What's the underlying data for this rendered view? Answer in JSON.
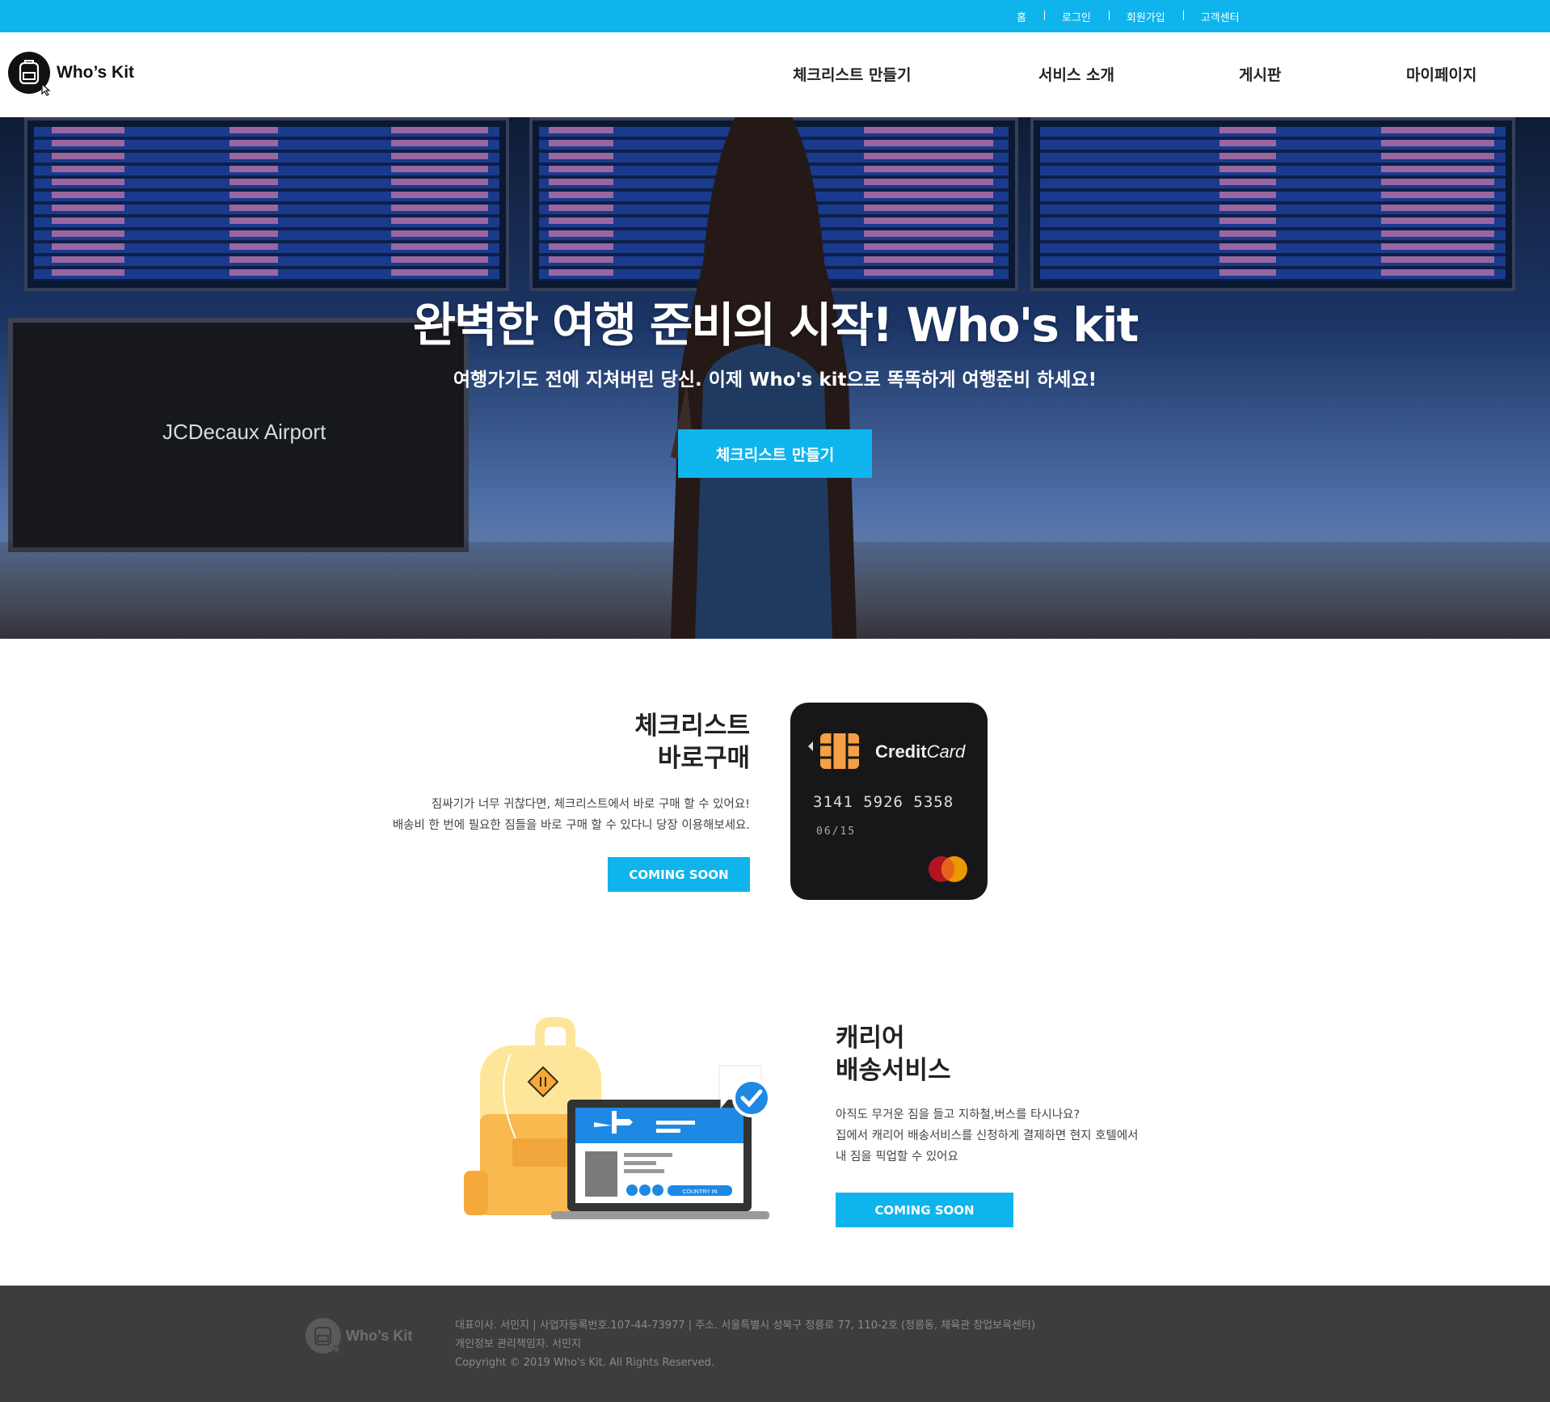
{
  "util_nav": {
    "items": [
      {
        "label": "홈"
      },
      {
        "label": "로그인"
      },
      {
        "label": "회원가입"
      },
      {
        "label": "고객센터"
      }
    ]
  },
  "header": {
    "logo_text": "Who’s Kit",
    "nav": [
      {
        "label": "체크리스트 만들기"
      },
      {
        "label": "서비스 소개"
      },
      {
        "label": "게시판"
      },
      {
        "label": "마이페이지"
      }
    ]
  },
  "hero": {
    "title": "완벽한 여행 준비의 시작! Who's kit",
    "subtitle": "여행가기도 전에 지쳐버린 당신. 이제 Who's kit으로 똑똑하게 여행준비 하세요!",
    "cta_label": "체크리스트 만들기",
    "screen_text": "JCDecaux Airport"
  },
  "feature_checklist": {
    "title_line1": "체크리스트",
    "title_line2": "바로구매",
    "desc_line1": "짐싸기가 너무 귀찮다면, 체크리스트에서 바로 구매 할 수 있어요!",
    "desc_line2": "배송비 한 번에 필요한 짐들을 바로 구매 할 수 있다니 당장 이용해보세요.",
    "button_label": "COMING SOON",
    "card": {
      "brand_bold": "Credit",
      "brand_light": "Card",
      "number": "3141  5926  5358",
      "expiry": "06/15"
    }
  },
  "feature_carrier": {
    "title_line1": "캐리어",
    "title_line2": "배송서비스",
    "desc_line1": "아직도 무거운 짐을 들고 지하철,버스를 타시나요?",
    "desc_line2": "집에서 캐리어 배송서비스를 신청하게 결제하면 현지 호텔에서",
    "desc_line3": "내 짐을 픽업할 수 있어요",
    "button_label": "COMING SOON",
    "illus_badge": "COUNTRY IN"
  },
  "footer": {
    "logo_text": "Who’s Kit",
    "line1": "대표이사. 서민지 | 사업자등록번호.107-44-73977 | 주소. 서울특별시 성북구 정릉로 77, 110-2호 (정릉동, 체육관 창업보육센터)",
    "line2": "개인정보 관리책임자. 서민지",
    "line3": "Copyright © 2019 Who's Kit. All Rights Reserved."
  },
  "colors": {
    "accent": "#10b4ec",
    "footer_bg": "#3d3d3d",
    "card_bg": "#17171a"
  }
}
